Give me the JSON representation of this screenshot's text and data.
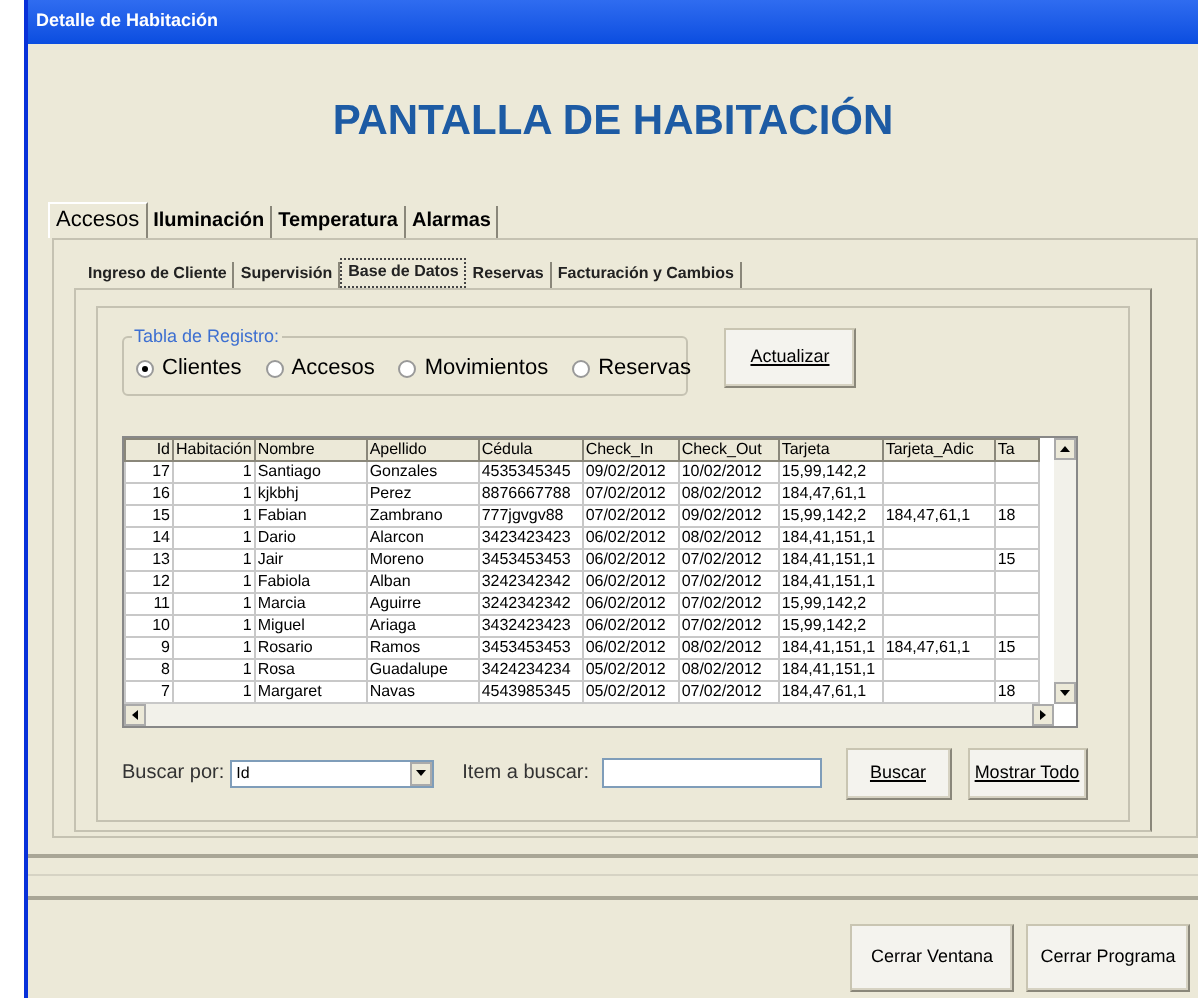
{
  "window": {
    "title": "Detalle de Habitación"
  },
  "heading": "PANTALLA DE HABITACIÓN",
  "tabs": [
    {
      "label": "Accesos",
      "selected": true
    },
    {
      "label": "Iluminación",
      "selected": false
    },
    {
      "label": "Temperatura",
      "selected": false
    },
    {
      "label": "Alarmas",
      "selected": false
    }
  ],
  "subtabs": [
    {
      "label": "Ingreso de Cliente",
      "selected": false
    },
    {
      "label": "Supervisión",
      "selected": false
    },
    {
      "label": "Base de Datos",
      "selected": true
    },
    {
      "label": "Reservas",
      "selected": false
    },
    {
      "label": "Facturación y Cambios",
      "selected": false
    }
  ],
  "registro": {
    "label": "Tabla de Registro:",
    "options": [
      {
        "label": "Clientes",
        "selected": true
      },
      {
        "label": "Accesos",
        "selected": false
      },
      {
        "label": "Movimientos",
        "selected": false
      },
      {
        "label": "Reservas",
        "selected": false
      }
    ]
  },
  "actualizar_button": "Actualizar",
  "table": {
    "columns": [
      "Id",
      "Habitación",
      "Nombre",
      "Apellido",
      "Cédula",
      "Check_In",
      "Check_Out",
      "Tarjeta",
      "Tarjeta_Adic",
      "Ta"
    ],
    "rows": [
      [
        "17",
        "1",
        "Santiago",
        "Gonzales",
        "4535345345",
        "09/02/2012",
        "10/02/2012",
        "15,99,142,2",
        "",
        ""
      ],
      [
        "16",
        "1",
        "kjkbhj",
        "Perez",
        "8876667788",
        "07/02/2012",
        "08/02/2012",
        "184,47,61,1",
        "",
        ""
      ],
      [
        "15",
        "1",
        "Fabian",
        "Zambrano",
        "777jgvgv88",
        "07/02/2012",
        "09/02/2012",
        "15,99,142,2",
        "184,47,61,1",
        "18"
      ],
      [
        "14",
        "1",
        "Dario",
        "Alarcon",
        "3423423423",
        "06/02/2012",
        "08/02/2012",
        "184,41,151,1",
        "",
        ""
      ],
      [
        "13",
        "1",
        "Jair",
        "Moreno",
        "3453453453",
        "06/02/2012",
        "07/02/2012",
        "184,41,151,1",
        "",
        "15"
      ],
      [
        "12",
        "1",
        "Fabiola",
        "Alban",
        "3242342342",
        "06/02/2012",
        "07/02/2012",
        "184,41,151,1",
        "",
        ""
      ],
      [
        "11",
        "1",
        "Marcia",
        "Aguirre",
        "3242342342",
        "06/02/2012",
        "07/02/2012",
        "15,99,142,2",
        "",
        ""
      ],
      [
        "10",
        "1",
        "Miguel",
        "Ariaga",
        "3432423423",
        "06/02/2012",
        "07/02/2012",
        "15,99,142,2",
        "",
        ""
      ],
      [
        "9",
        "1",
        "Rosario",
        "Ramos",
        "3453453453",
        "06/02/2012",
        "08/02/2012",
        "184,41,151,1",
        "184,47,61,1",
        "15"
      ],
      [
        "8",
        "1",
        "Rosa",
        "Guadalupe",
        "3424234234",
        "05/02/2012",
        "08/02/2012",
        "184,41,151,1",
        "",
        ""
      ],
      [
        "7",
        "1",
        "Margaret",
        "Navas",
        "4543985345",
        "05/02/2012",
        "07/02/2012",
        "184,47,61,1",
        "",
        "18"
      ]
    ]
  },
  "search": {
    "label": "Buscar por:",
    "value": "Id",
    "item_label": "Item a buscar:",
    "buscar_button": "Buscar",
    "mostrar_button": "Mostrar Todo"
  },
  "footer_buttons": [
    "Cerrar Ventana",
    "Cerrar Programa"
  ]
}
